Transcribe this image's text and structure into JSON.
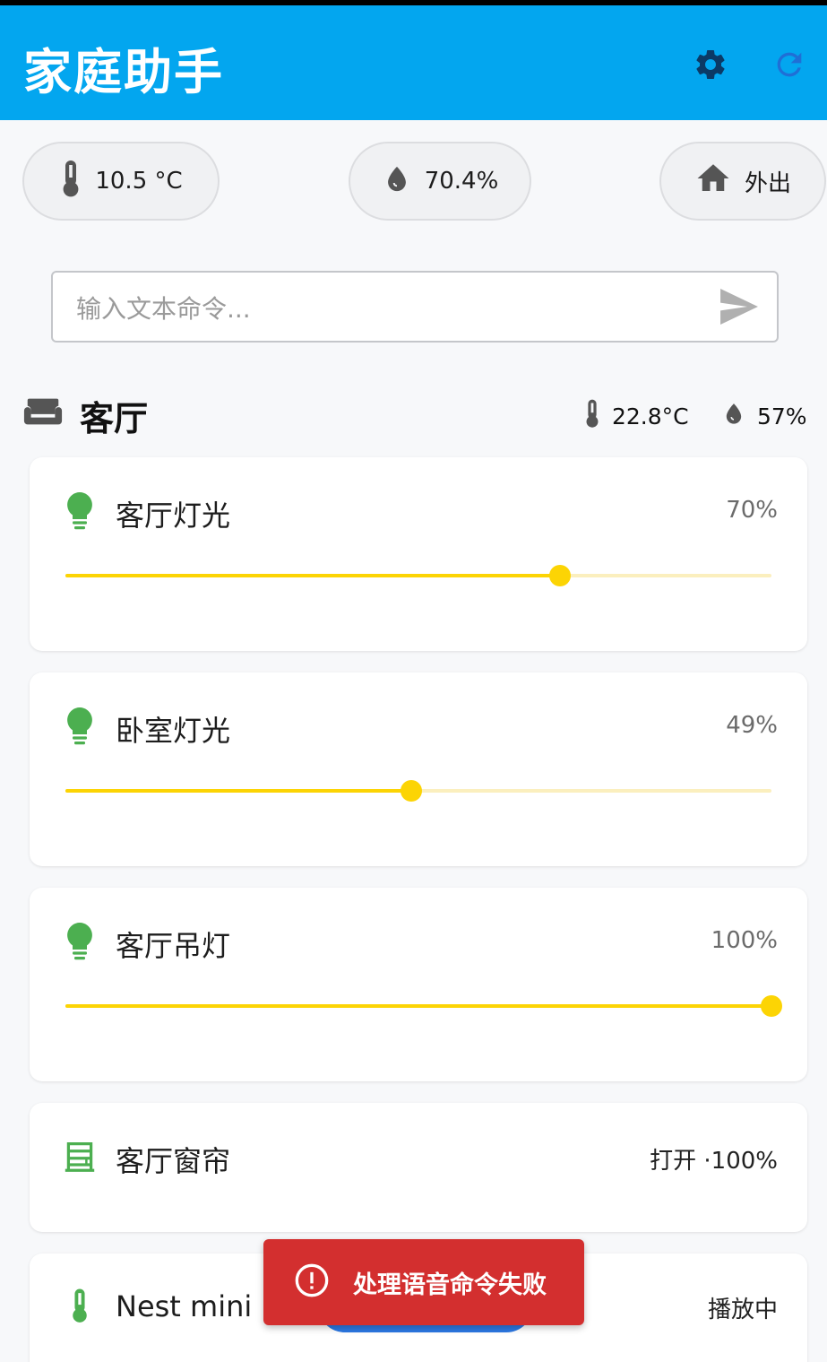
{
  "app": {
    "title": "家庭助手"
  },
  "appbar": {
    "settings_icon": "gear-icon",
    "refresh_icon": "refresh-icon"
  },
  "status_chips": {
    "outdoor_temperature": "10.5 °C",
    "outdoor_humidity": "70.4%",
    "home_mode": "外出"
  },
  "command": {
    "placeholder": "输入文本命令...",
    "value": ""
  },
  "room": {
    "name": "客厅",
    "temperature": "22.8°C",
    "humidity": "57%"
  },
  "devices": [
    {
      "name": "客厅灯光",
      "type": "light",
      "brightness_label": "70%",
      "brightness": 0.7
    },
    {
      "name": "卧室灯光",
      "type": "light",
      "brightness_label": "49%",
      "brightness": 0.49
    },
    {
      "name": "客厅吊灯",
      "type": "light",
      "brightness_label": "100%",
      "brightness": 1.0
    },
    {
      "name": "客厅窗帘",
      "type": "curtain",
      "state": "打开 ·100%"
    },
    {
      "name": "Nest mini",
      "type": "media",
      "state": "播放中"
    }
  ],
  "snackbar": {
    "message": "处理语音命令失败",
    "icon": "error-icon"
  },
  "colors": {
    "appbar": "#03a6ef",
    "slider_active": "#fcd404",
    "slider_inactive": "#fbefbe",
    "device_icon": "#4caf50",
    "snackbar": "#d32f2f",
    "fab": "#2c78e4"
  }
}
